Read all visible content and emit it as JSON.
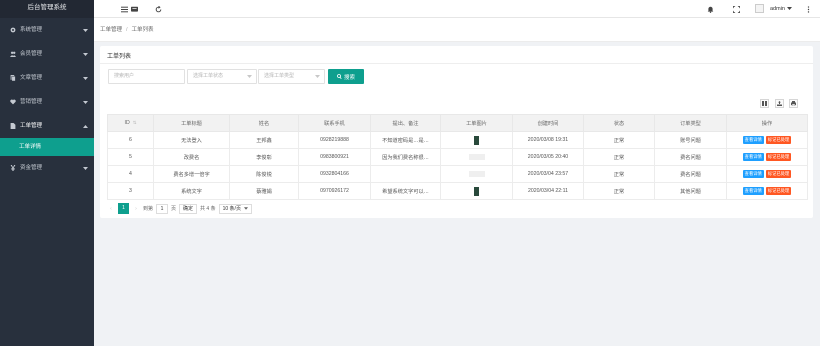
{
  "app": {
    "title": "后台管理系统"
  },
  "sidebar": {
    "items": [
      {
        "label": "系统管理",
        "icon": "gear-icon",
        "chevron": "down"
      },
      {
        "label": "会员管理",
        "icon": "users-icon",
        "chevron": "down"
      },
      {
        "label": "文章管理",
        "icon": "document-icon",
        "chevron": "down"
      },
      {
        "label": "营销管理",
        "icon": "heart-icon",
        "chevron": "down"
      },
      {
        "label": "工单管理",
        "icon": "file-icon",
        "chevron": "up"
      },
      {
        "label": "资金管理",
        "icon": "yen-icon",
        "chevron": "down"
      }
    ],
    "subitem": {
      "label": "工单详情"
    }
  },
  "topbar": {
    "icons": [
      "menu-icon",
      "chat-icon",
      "refresh-icon",
      "bell-icon",
      "fullscreen-icon",
      "more-icon"
    ],
    "user": "admin"
  },
  "breadcrumb": {
    "home": "工单管理",
    "sep": "/",
    "current": "工单列表"
  },
  "card": {
    "title": "工单列表"
  },
  "filters": {
    "user_placeholder": "搜索用户",
    "status_placeholder": "选择工单状态",
    "type_placeholder": "选择工单类型",
    "search_label": "搜索"
  },
  "table": {
    "headers": [
      "ID",
      "工单标题",
      "姓名",
      "联系手机",
      "提出、备注",
      "工单图片",
      "创建时间",
      "状态",
      "订单类型",
      "操作"
    ],
    "rows": [
      {
        "id": "6",
        "title": "无法登入",
        "name": "王邦鑫",
        "phone": "0928219888",
        "note": "不知道密码是…是…",
        "img": "dark",
        "time": "2020/03/08 19:31",
        "status": "正常",
        "type": "账号问题"
      },
      {
        "id": "5",
        "title": "改费名",
        "name": "李俊彰",
        "phone": "0983800921",
        "note": "因为我们费名称很…",
        "img": "light",
        "time": "2020/03/05 20:40",
        "status": "正常",
        "type": "费名问题"
      },
      {
        "id": "4",
        "title": "费名多增一倍字",
        "name": "陈俊锐",
        "phone": "0932804166",
        "note": "",
        "img": "light",
        "time": "2020/03/04 23:57",
        "status": "正常",
        "type": "费名问题"
      },
      {
        "id": "3",
        "title": "系统文字",
        "name": "蔡雅娟",
        "phone": "0970926172",
        "note": "希望系统文字可以…",
        "img": "dark",
        "time": "2020/03/04 22:11",
        "status": "正常",
        "type": "其他问题"
      }
    ],
    "actions": {
      "view": "查看详情",
      "mark": "标记已处理"
    }
  },
  "pager": {
    "current": "1",
    "goto_label": "到第",
    "page_input": "1",
    "page_unit": "页",
    "confirm": "确定",
    "total": "共 4 条",
    "per_page": "10 条/页"
  }
}
